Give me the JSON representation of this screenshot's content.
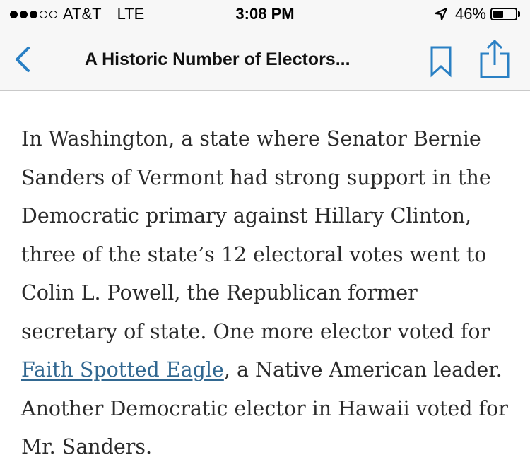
{
  "status_bar": {
    "signal_bars_filled": 3,
    "signal_bars_total": 5,
    "carrier": "AT&T",
    "network": "LTE",
    "time": "3:08 PM",
    "battery_percent": "46%",
    "battery_level": 0.46,
    "icons": [
      "location-arrow-icon",
      "battery-icon"
    ]
  },
  "nav": {
    "title": "A Historic Number of Electors...",
    "icons": [
      "back-chevron-icon",
      "bookmark-icon",
      "share-icon"
    ],
    "accent_color": "#2a80c4"
  },
  "article": {
    "text_before_link": "In Washington, a state where Senator Bernie Sanders of Vermont had strong support in the Democratic primary against Hillary Clinton, three of the state’s 12 electoral votes went to Colin L. Powell, the Republican former secretary of state. One more elector voted for ",
    "link_text": "Faith Spotted Eagle",
    "text_after_link": ", a Native American leader. Another Democratic elector in Hawaii voted for Mr. Sanders.",
    "link_color": "#326891"
  }
}
